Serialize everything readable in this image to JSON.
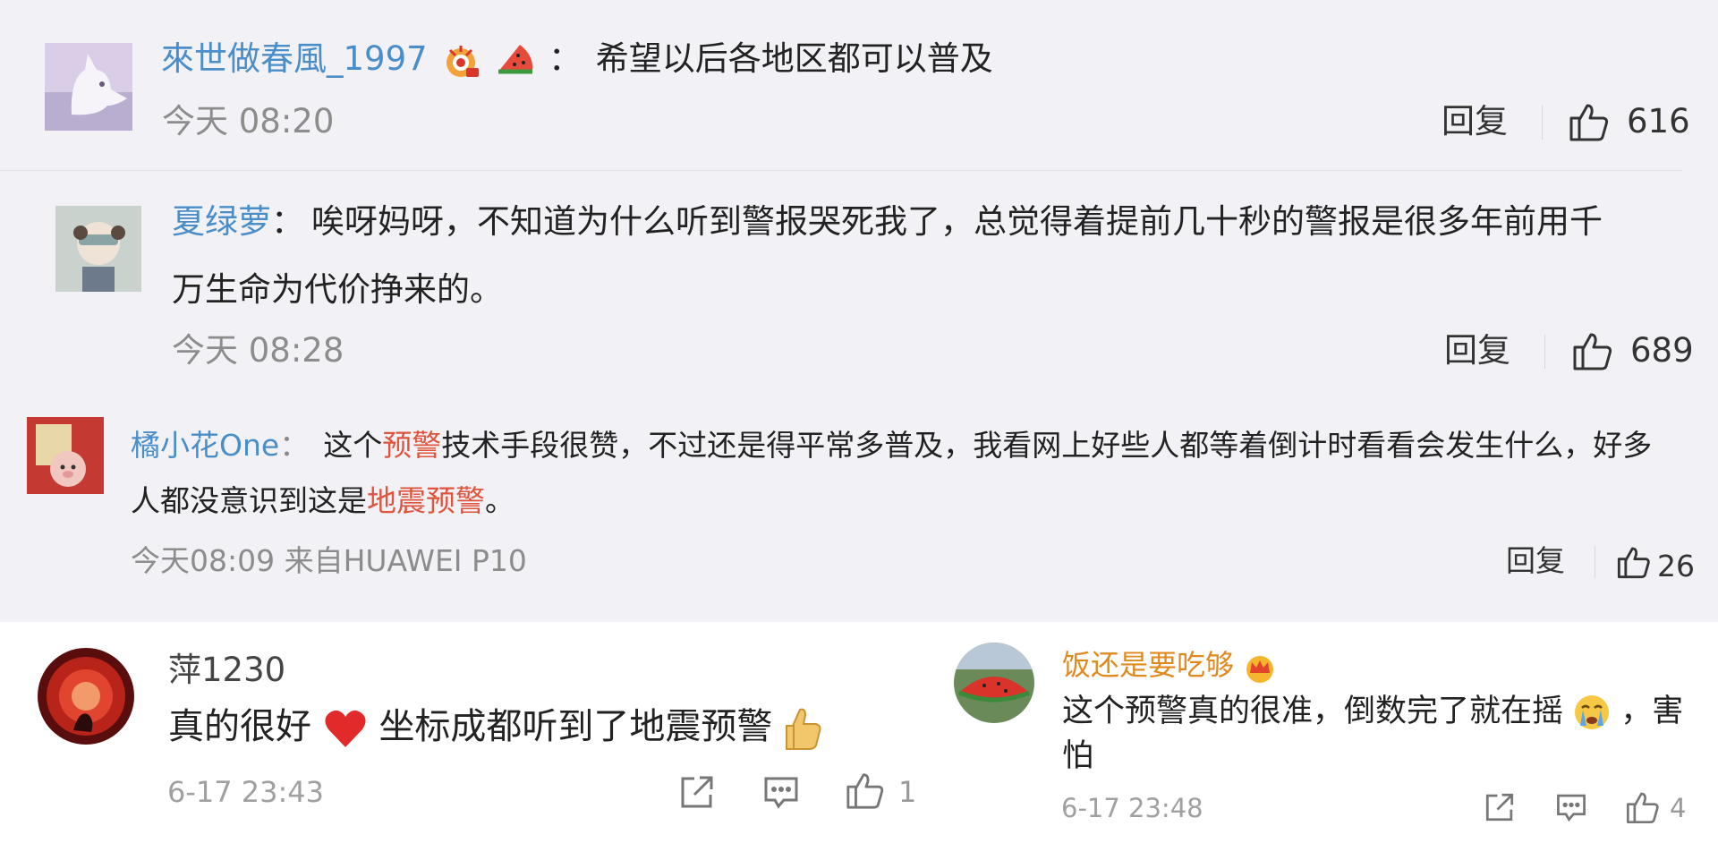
{
  "comments": [
    {
      "username": "來世做春風_1997",
      "separator": "：",
      "text": "希望以后各地区都可以普及",
      "time": "今天 08:20",
      "reply": "回复",
      "likes": "616"
    },
    {
      "username": "夏绿萝",
      "separator": "：",
      "text_line1": "唉呀妈呀，不知道为什么听到警报哭死我了，总觉得着提前几十秒的警报是很多年前用千",
      "text_line2": "万生命为代价挣来的。",
      "time": "今天 08:28",
      "reply": "回复",
      "likes": "689"
    },
    {
      "username": "橘小花One",
      "separator": "：",
      "text_a": "这个",
      "text_b": "预警",
      "text_c": "技术手段很赞，不过还是得平常多普及，我看网上好些人都等着倒计时看看会发生什么，好多",
      "text_d": "人都没意识到这是",
      "text_e": "地震预警",
      "text_f": "。",
      "time": "今天08:09 来自HUAWEI P10",
      "reply": "回复",
      "likes": "26"
    },
    {
      "username": "萍1230",
      "text_a": "真的很好",
      "text_b": "坐标成都听到了地震预警",
      "time": "6-17 23:43",
      "likes": "1"
    },
    {
      "username": "饭还是要吃够",
      "text_a": "这个预警真的很准，倒数完了就在摇",
      "text_b": "，害",
      "text_c": "怕",
      "time": "6-17 23:48",
      "likes": "4"
    }
  ],
  "icons": {
    "like": "thumbs-up-icon",
    "share": "share-icon",
    "comment": "comment-icon",
    "badge": "crown-icon"
  },
  "colors": {
    "username_blue": "#4a8ec9",
    "username_orange": "#e08a1e",
    "highlight_red": "#e0533d",
    "time_gray": "#8c8c8c",
    "top_background": "#f2f2f6"
  }
}
